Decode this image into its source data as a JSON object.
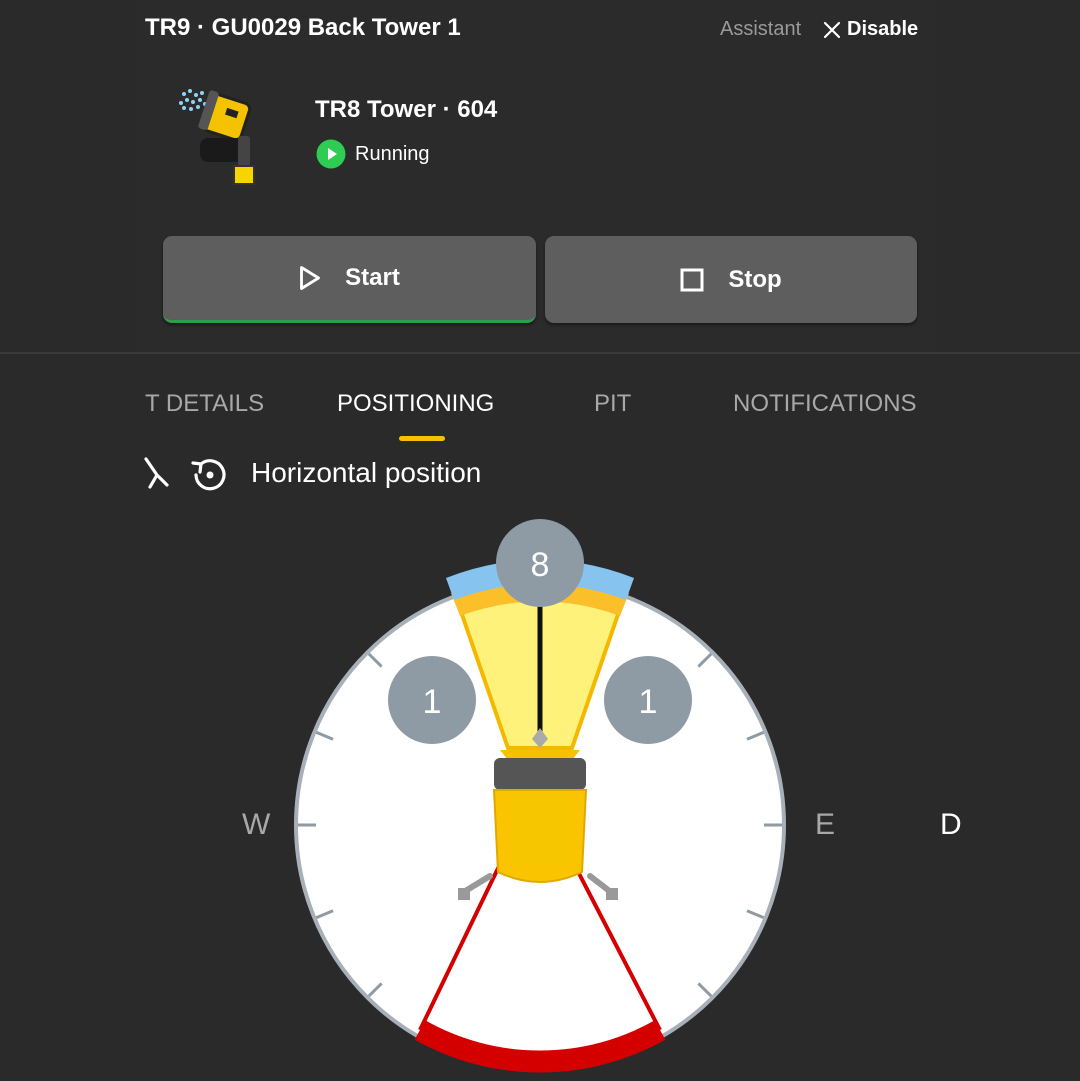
{
  "header": {
    "title": "TR9 · GU0029 Back Tower 1",
    "assistant_label": "Assistant",
    "assistant_action": "Disable",
    "close_icon": "close-icon"
  },
  "device": {
    "name": "TR8 Tower · 604",
    "status": "Running",
    "status_color": "#2ecc52",
    "image_icon": "tower-device-icon"
  },
  "controls": {
    "start_label": "Start",
    "stop_label": "Stop",
    "start_icon": "play-outline-icon",
    "stop_icon": "stop-square-icon",
    "active_indicator_color": "#2e9e4b"
  },
  "tabs": [
    {
      "label": "T DETAILS",
      "active": false
    },
    {
      "label": "POSITIONING",
      "active": true
    },
    {
      "label": "PIT",
      "active": false
    },
    {
      "label": "NOTIFICATIONS",
      "active": false
    }
  ],
  "positioning": {
    "title": "Horizontal position",
    "icons": [
      "angle-icon",
      "rotate-reset-icon"
    ],
    "center_value": "8",
    "left_value": "1",
    "right_value": "1",
    "compass": {
      "west": "W",
      "east": "E",
      "edge": "D"
    },
    "colors": {
      "sector_fill": "#fff27a",
      "sector_edge": "#f5b800",
      "sector_top": "#fbbf2a",
      "limit_blue": "#87c3ef",
      "dead_zone": "#d40000",
      "badge": "#8e9aa4"
    }
  }
}
